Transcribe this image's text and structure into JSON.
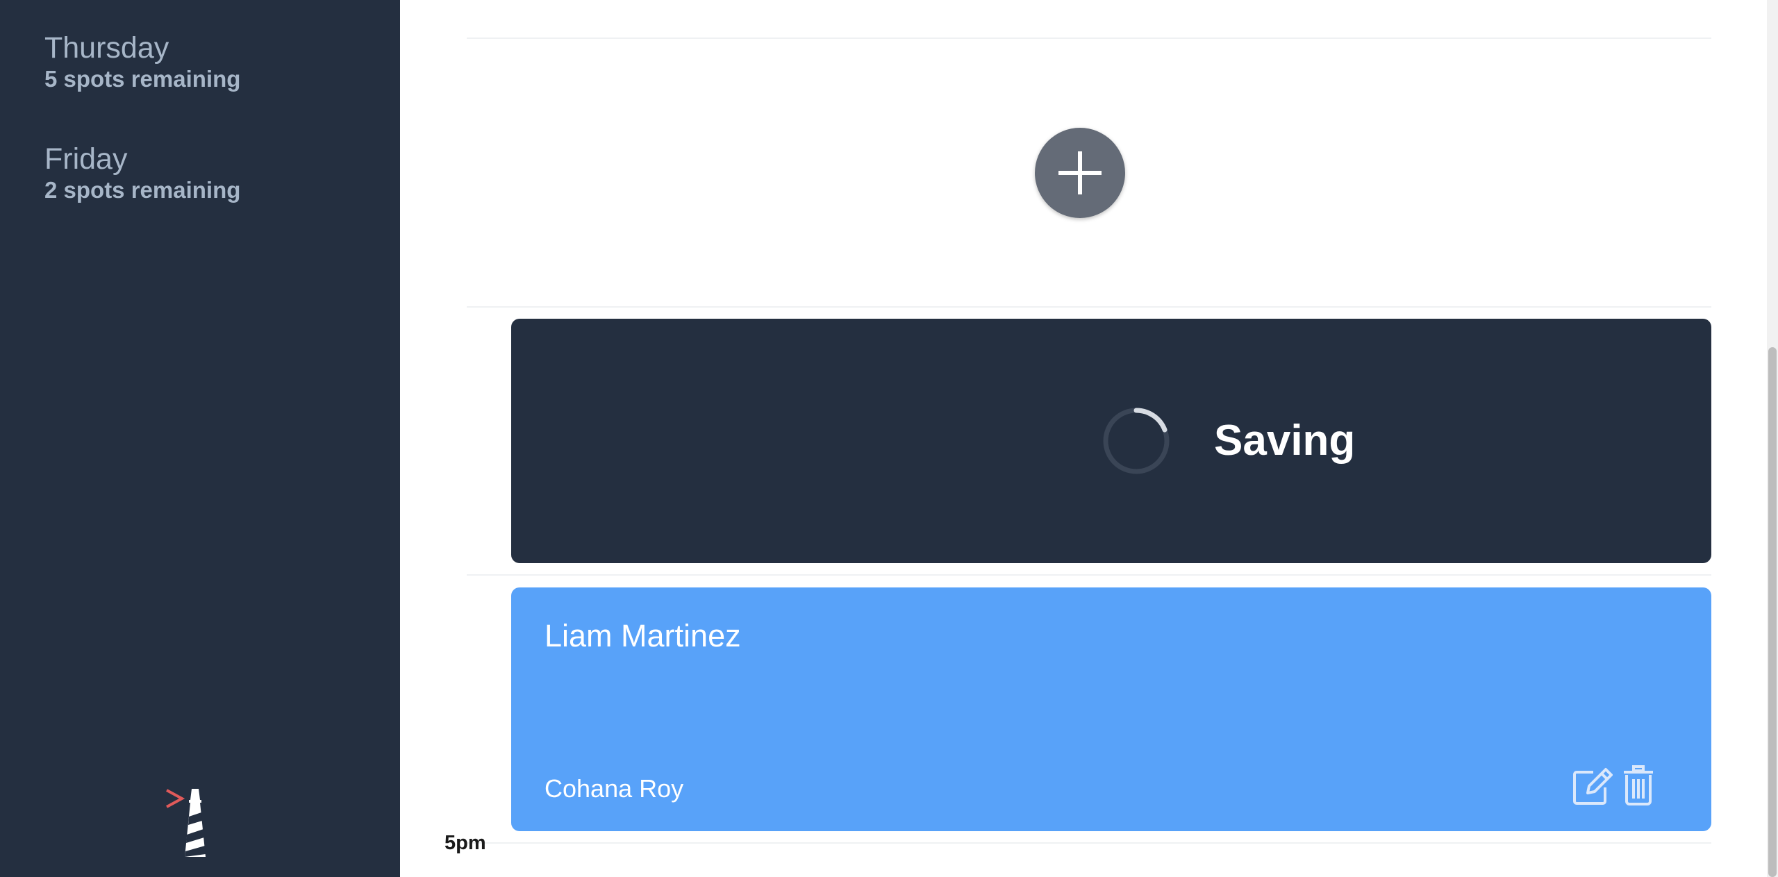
{
  "sidebar": {
    "days": [
      {
        "name": "Thursday",
        "spots": "5 spots remaining"
      },
      {
        "name": "Friday",
        "spots": "2 spots remaining"
      }
    ]
  },
  "schedule": {
    "saving_label": "Saving",
    "appointment": {
      "title": "Liam Martinez",
      "subtitle": "Cohana Roy"
    },
    "time_label": "5pm"
  },
  "colors": {
    "sidebar_bg": "#242f40",
    "saving_bg": "#242f40",
    "card_bg": "#58a2f9",
    "add_button_bg": "#646b77",
    "logo_accent": "#e05a5a"
  },
  "icons": [
    "plus-icon",
    "spinner-icon",
    "edit-icon",
    "trash-icon",
    "lighthouse-logo"
  ]
}
